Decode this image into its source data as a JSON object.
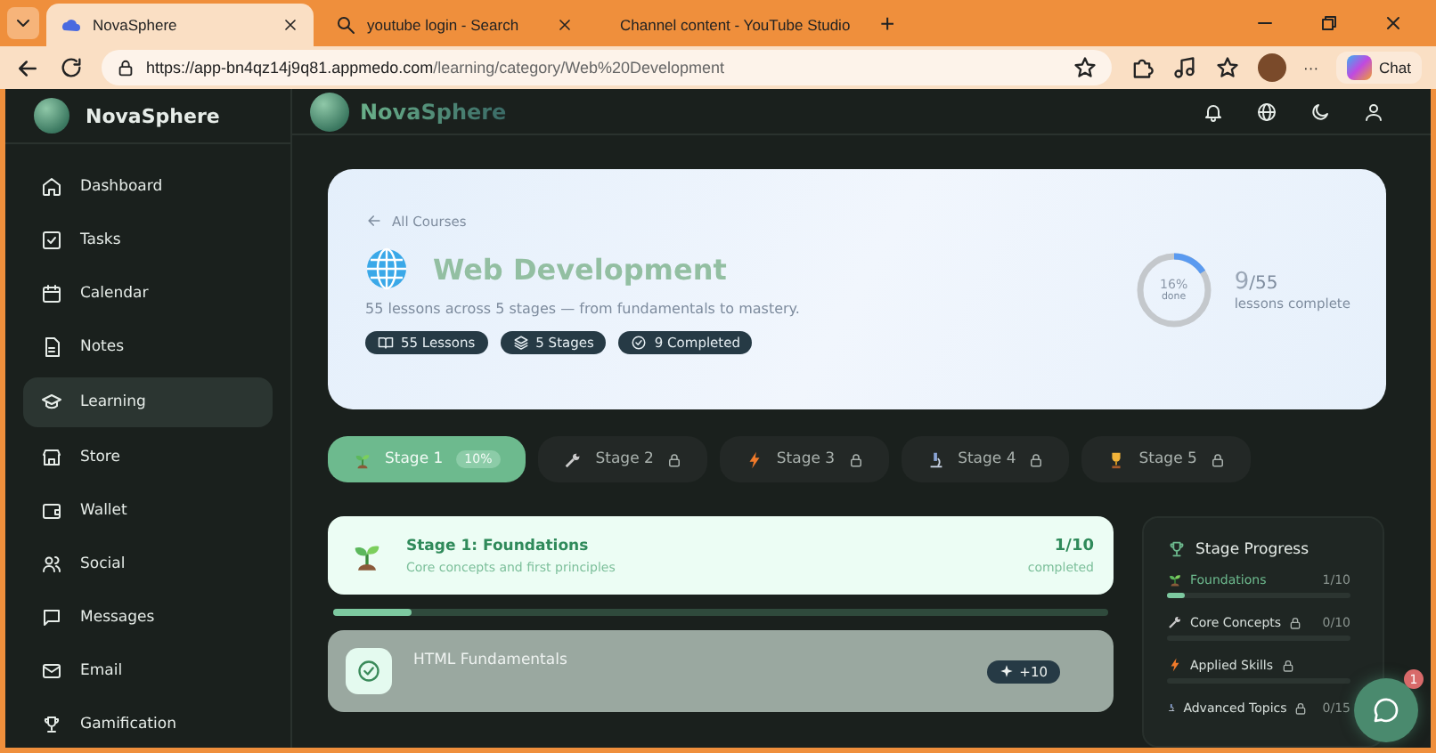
{
  "browser": {
    "tabs": [
      {
        "title": "NovaSphere",
        "selected": true
      },
      {
        "title": "youtube login - Search",
        "selected": false
      },
      {
        "title": "Channel content - YouTube Studio",
        "selected": false
      }
    ],
    "new_tab": "+",
    "url_host": "https://app-bn4qz14j9q81.appmedo.com",
    "url_path": "/learning/category/Web%20Development",
    "more": "···",
    "chat": "Chat"
  },
  "sidebar": {
    "brand": "NovaSphere",
    "items": [
      {
        "label": "Dashboard",
        "selected": false
      },
      {
        "label": "Tasks",
        "selected": false
      },
      {
        "label": "Calendar",
        "selected": false
      },
      {
        "label": "Notes",
        "selected": false
      },
      {
        "label": "Learning",
        "selected": true
      },
      {
        "label": "Store",
        "selected": false
      },
      {
        "label": "Wallet",
        "selected": false
      },
      {
        "label": "Social",
        "selected": false
      },
      {
        "label": "Messages",
        "selected": false
      },
      {
        "label": "Email",
        "selected": false
      },
      {
        "label": "Gamification",
        "selected": false
      }
    ]
  },
  "header": {
    "brand": "NovaSphere"
  },
  "hero": {
    "back": "All Courses",
    "title": "Web Development",
    "description": "55 lessons across 5 stages — from fundamentals to mastery.",
    "chips": [
      {
        "label": "55 Lessons"
      },
      {
        "label": "5 Stages"
      },
      {
        "label": "9 Completed"
      }
    ],
    "ring": {
      "level": 0.16,
      "percent": "16%",
      "caption": "done"
    },
    "done": "9",
    "total": "/55",
    "caption": "lessons complete"
  },
  "stage_tabs": [
    {
      "label": "Stage 1",
      "badge": "10%",
      "selected": true,
      "locked": false
    },
    {
      "label": "Stage 2",
      "selected": false,
      "locked": true
    },
    {
      "label": "Stage 3",
      "selected": false,
      "locked": true
    },
    {
      "label": "Stage 4",
      "selected": false,
      "locked": true
    },
    {
      "label": "Stage 5",
      "selected": false,
      "locked": true
    }
  ],
  "stage": {
    "title": "Stage 1: Foundations",
    "subtitle": "Core concepts and first principles",
    "count": "1/10",
    "count_caption": "completed",
    "level": 0.1
  },
  "lessons": [
    {
      "title": "HTML Fundamentals",
      "xp": "+10",
      "completed": true
    }
  ],
  "progress": {
    "title": "Stage Progress",
    "items": [
      {
        "name": "Foundations",
        "count": "1/10",
        "level": 0.1,
        "locked": false,
        "selected": true
      },
      {
        "name": "Core Concepts",
        "count": "0/10",
        "level": 0,
        "locked": true,
        "selected": false
      },
      {
        "name": "Applied Skills",
        "level": 0,
        "locked": true,
        "selected": false
      },
      {
        "name": "Advanced Topics",
        "count": "0/15",
        "locked": true,
        "selected": false
      }
    ]
  },
  "chat_fab": {
    "badge": "1"
  }
}
